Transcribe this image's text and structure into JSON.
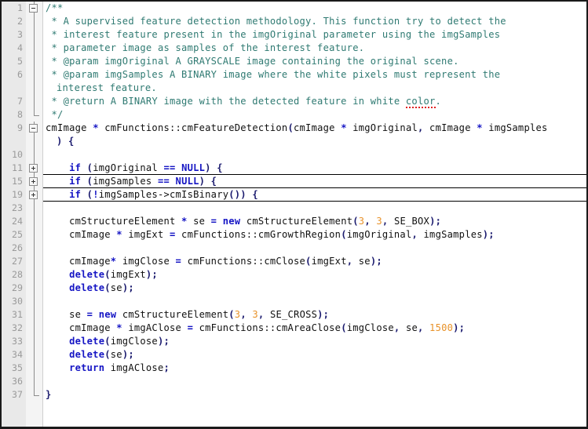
{
  "editor": {
    "language": "C++",
    "colors": {
      "background": "#ffffff",
      "gutter": "#e9e9e9",
      "fold_column": "#f4f4f4",
      "line_number": "#9a9a9a",
      "comment": "#2f7a72",
      "keyword": "#1515c4",
      "number": "#e8922a",
      "identifier": "#101010",
      "punctuation": "#1a1a6e",
      "spell_error_underline": "#e02020",
      "fold_rule": "#000000",
      "border": "#1a1a1a"
    },
    "fold_markers": {
      "collapse": "minus-box",
      "expand": "plus-box"
    },
    "lines": [
      {
        "number": "1",
        "fold": "minus",
        "tokens": [
          {
            "t": "/**",
            "c": "cmt"
          }
        ]
      },
      {
        "number": "2",
        "fold": "line",
        "tokens": [
          {
            "t": " * A supervised feature detection methodology. This function try to detect the",
            "c": "cmt"
          }
        ]
      },
      {
        "number": "3",
        "fold": "line",
        "tokens": [
          {
            "t": " * interest feature present in the imgOriginal parameter using the imgSamples",
            "c": "cmt"
          }
        ]
      },
      {
        "number": "4",
        "fold": "line",
        "tokens": [
          {
            "t": " * parameter image as samples of the interest feature.",
            "c": "cmt"
          }
        ]
      },
      {
        "number": "5",
        "fold": "line",
        "tokens": [
          {
            "t": " * @param imgOriginal A GRAYSCALE image containing the original scene.",
            "c": "cmt"
          }
        ]
      },
      {
        "number": "6",
        "fold": "line",
        "tokens": [
          {
            "t": " * @param imgSamples A BINARY image where the white pixels must represent the",
            "c": "cmt"
          }
        ]
      },
      {
        "number": "",
        "fold": "line",
        "wrapped": true,
        "tokens": [
          {
            "t": "interest feature.",
            "c": "cmt"
          }
        ]
      },
      {
        "number": "7",
        "fold": "line",
        "tokens": [
          {
            "t": " * @return A BINARY image with the detected feature in white ",
            "c": "cmt"
          },
          {
            "t": "color",
            "c": "cmt",
            "spell": true
          },
          {
            "t": ".",
            "c": "cmt"
          }
        ]
      },
      {
        "number": "8",
        "fold": "end",
        "tokens": [
          {
            "t": " */",
            "c": "cmt"
          }
        ]
      },
      {
        "number": "9",
        "fold": "minus",
        "tokens": [
          {
            "t": "cmImage ",
            "c": "id"
          },
          {
            "t": "*",
            "c": "op"
          },
          {
            "t": " cmFunctions::cmFeatureDetection",
            "c": "id"
          },
          {
            "t": "(",
            "c": "pn"
          },
          {
            "t": "cmImage ",
            "c": "id"
          },
          {
            "t": "*",
            "c": "op"
          },
          {
            "t": " imgOriginal",
            "c": "id"
          },
          {
            "t": ",",
            "c": "pn"
          },
          {
            "t": " cmImage ",
            "c": "id"
          },
          {
            "t": "*",
            "c": "op"
          },
          {
            "t": " imgSamples",
            "c": "id"
          }
        ]
      },
      {
        "number": "",
        "fold": "line",
        "wrapped": true,
        "tokens": [
          {
            "t": ") {",
            "c": "pn"
          }
        ]
      },
      {
        "number": "10",
        "fold": "line",
        "tokens": []
      },
      {
        "number": "11",
        "fold": "plus",
        "folded": true,
        "tokens": [
          {
            "t": "    ",
            "c": "id"
          },
          {
            "t": "if",
            "c": "kw"
          },
          {
            "t": " ",
            "c": "id"
          },
          {
            "t": "(",
            "c": "pn"
          },
          {
            "t": "imgOriginal ",
            "c": "id"
          },
          {
            "t": "==",
            "c": "op"
          },
          {
            "t": " ",
            "c": "id"
          },
          {
            "t": "NULL",
            "c": "kw"
          },
          {
            "t": ") {",
            "c": "pn"
          }
        ]
      },
      {
        "number": "15",
        "fold": "plus",
        "folded": true,
        "tokens": [
          {
            "t": "    ",
            "c": "id"
          },
          {
            "t": "if",
            "c": "kw"
          },
          {
            "t": " ",
            "c": "id"
          },
          {
            "t": "(",
            "c": "pn"
          },
          {
            "t": "imgSamples ",
            "c": "id"
          },
          {
            "t": "==",
            "c": "op"
          },
          {
            "t": " ",
            "c": "id"
          },
          {
            "t": "NULL",
            "c": "kw"
          },
          {
            "t": ") {",
            "c": "pn"
          }
        ]
      },
      {
        "number": "19",
        "fold": "plus",
        "folded": true,
        "tokens": [
          {
            "t": "    ",
            "c": "id"
          },
          {
            "t": "if",
            "c": "kw"
          },
          {
            "t": " ",
            "c": "id"
          },
          {
            "t": "(",
            "c": "pn"
          },
          {
            "t": "!",
            "c": "op"
          },
          {
            "t": "imgSamples->cmIsBinary",
            "c": "id"
          },
          {
            "t": "()) {",
            "c": "pn"
          }
        ]
      },
      {
        "number": "23",
        "fold": "line",
        "tokens": []
      },
      {
        "number": "24",
        "fold": "line",
        "tokens": [
          {
            "t": "    cmStructureElement ",
            "c": "id"
          },
          {
            "t": "*",
            "c": "op"
          },
          {
            "t": " se ",
            "c": "id"
          },
          {
            "t": "=",
            "c": "op"
          },
          {
            "t": " ",
            "c": "id"
          },
          {
            "t": "new",
            "c": "kw"
          },
          {
            "t": " cmStructureElement",
            "c": "id"
          },
          {
            "t": "(",
            "c": "pn"
          },
          {
            "t": "3",
            "c": "num"
          },
          {
            "t": ", ",
            "c": "pn"
          },
          {
            "t": "3",
            "c": "num"
          },
          {
            "t": ", ",
            "c": "pn"
          },
          {
            "t": "SE_BOX",
            "c": "id"
          },
          {
            "t": ");",
            "c": "pn"
          }
        ]
      },
      {
        "number": "25",
        "fold": "line",
        "tokens": [
          {
            "t": "    cmImage ",
            "c": "id"
          },
          {
            "t": "*",
            "c": "op"
          },
          {
            "t": " imgExt ",
            "c": "id"
          },
          {
            "t": "=",
            "c": "op"
          },
          {
            "t": " cmFunctions::cmGrowthRegion",
            "c": "id"
          },
          {
            "t": "(",
            "c": "pn"
          },
          {
            "t": "imgOriginal",
            "c": "id"
          },
          {
            "t": ", ",
            "c": "pn"
          },
          {
            "t": "imgSamples",
            "c": "id"
          },
          {
            "t": ");",
            "c": "pn"
          }
        ]
      },
      {
        "number": "26",
        "fold": "line",
        "tokens": []
      },
      {
        "number": "27",
        "fold": "line",
        "tokens": [
          {
            "t": "    cmImage",
            "c": "id"
          },
          {
            "t": "*",
            "c": "op"
          },
          {
            "t": " imgClose ",
            "c": "id"
          },
          {
            "t": "=",
            "c": "op"
          },
          {
            "t": " cmFunctions::cmClose",
            "c": "id"
          },
          {
            "t": "(",
            "c": "pn"
          },
          {
            "t": "imgExt",
            "c": "id"
          },
          {
            "t": ", ",
            "c": "pn"
          },
          {
            "t": "se",
            "c": "id"
          },
          {
            "t": ");",
            "c": "pn"
          }
        ]
      },
      {
        "number": "28",
        "fold": "line",
        "tokens": [
          {
            "t": "    ",
            "c": "id"
          },
          {
            "t": "delete",
            "c": "kw"
          },
          {
            "t": "(",
            "c": "pn"
          },
          {
            "t": "imgExt",
            "c": "id"
          },
          {
            "t": ");",
            "c": "pn"
          }
        ]
      },
      {
        "number": "29",
        "fold": "line",
        "tokens": [
          {
            "t": "    ",
            "c": "id"
          },
          {
            "t": "delete",
            "c": "kw"
          },
          {
            "t": "(",
            "c": "pn"
          },
          {
            "t": "se",
            "c": "id"
          },
          {
            "t": ");",
            "c": "pn"
          }
        ]
      },
      {
        "number": "30",
        "fold": "line",
        "tokens": []
      },
      {
        "number": "31",
        "fold": "line",
        "tokens": [
          {
            "t": "    se ",
            "c": "id"
          },
          {
            "t": "=",
            "c": "op"
          },
          {
            "t": " ",
            "c": "id"
          },
          {
            "t": "new",
            "c": "kw"
          },
          {
            "t": " cmStructureElement",
            "c": "id"
          },
          {
            "t": "(",
            "c": "pn"
          },
          {
            "t": "3",
            "c": "num"
          },
          {
            "t": ", ",
            "c": "pn"
          },
          {
            "t": "3",
            "c": "num"
          },
          {
            "t": ", ",
            "c": "pn"
          },
          {
            "t": "SE_CROSS",
            "c": "id"
          },
          {
            "t": ");",
            "c": "pn"
          }
        ]
      },
      {
        "number": "32",
        "fold": "line",
        "tokens": [
          {
            "t": "    cmImage ",
            "c": "id"
          },
          {
            "t": "*",
            "c": "op"
          },
          {
            "t": " imgAClose ",
            "c": "id"
          },
          {
            "t": "=",
            "c": "op"
          },
          {
            "t": " cmFunctions::cmAreaClose",
            "c": "id"
          },
          {
            "t": "(",
            "c": "pn"
          },
          {
            "t": "imgClose",
            "c": "id"
          },
          {
            "t": ", ",
            "c": "pn"
          },
          {
            "t": "se",
            "c": "id"
          },
          {
            "t": ", ",
            "c": "pn"
          },
          {
            "t": "1500",
            "c": "num"
          },
          {
            "t": ");",
            "c": "pn"
          }
        ]
      },
      {
        "number": "33",
        "fold": "line",
        "tokens": [
          {
            "t": "    ",
            "c": "id"
          },
          {
            "t": "delete",
            "c": "kw"
          },
          {
            "t": "(",
            "c": "pn"
          },
          {
            "t": "imgClose",
            "c": "id"
          },
          {
            "t": ");",
            "c": "pn"
          }
        ]
      },
      {
        "number": "34",
        "fold": "line",
        "tokens": [
          {
            "t": "    ",
            "c": "id"
          },
          {
            "t": "delete",
            "c": "kw"
          },
          {
            "t": "(",
            "c": "pn"
          },
          {
            "t": "se",
            "c": "id"
          },
          {
            "t": ");",
            "c": "pn"
          }
        ]
      },
      {
        "number": "35",
        "fold": "line",
        "tokens": [
          {
            "t": "    ",
            "c": "id"
          },
          {
            "t": "return",
            "c": "kw"
          },
          {
            "t": " imgAClose",
            "c": "id"
          },
          {
            "t": ";",
            "c": "pn"
          }
        ]
      },
      {
        "number": "36",
        "fold": "line",
        "tokens": []
      },
      {
        "number": "37",
        "fold": "end",
        "tokens": [
          {
            "t": "}",
            "c": "pn"
          }
        ]
      }
    ]
  }
}
